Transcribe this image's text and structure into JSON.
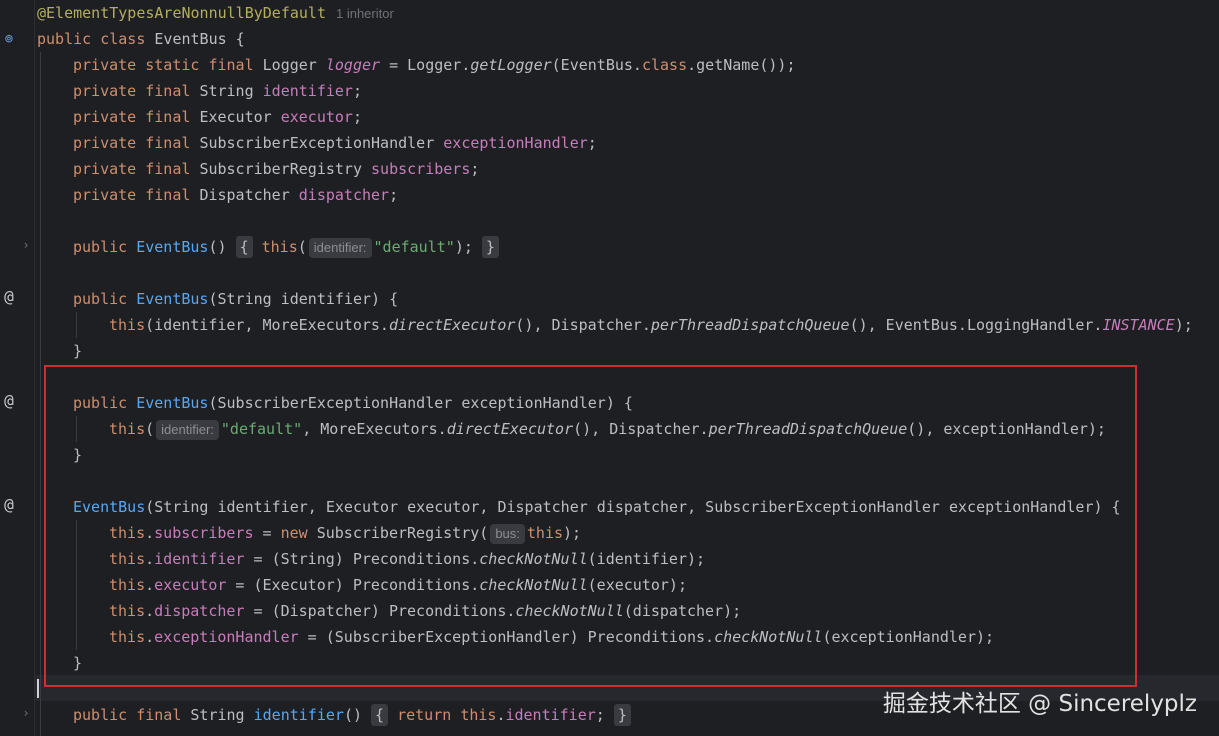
{
  "annotation": "@ElementTypesAreNonnullByDefault",
  "inheritor_hint": "1 inheritor",
  "gutter_icons": {
    "class_icon": "implemented-class-icon",
    "at_icon": "@"
  },
  "code": {
    "kw_public": "public",
    "kw_class": "class",
    "kw_private": "private",
    "kw_static": "static",
    "kw_final": "final",
    "kw_this": "this",
    "kw_new": "new",
    "kw_return": "return",
    "class_name": "EventBus",
    "open_brace": " {",
    "close_brace": "}",
    "logger_type": "Logger",
    "logger_field": "logger",
    "logger_init_a": " = Logger.",
    "logger_getLogger": "getLogger",
    "logger_init_b": "(EventBus.",
    "logger_class_kw": "class",
    "logger_init_c": ".getName());",
    "string_type": "String",
    "identifier_field": "identifier",
    "executor_type": "Executor",
    "executor_field": "executor",
    "handler_type": "SubscriberExceptionHandler",
    "handler_field": "exceptionHandler",
    "registry_type": "SubscriberRegistry",
    "subscribers_field": "subscribers",
    "dispatcher_type": "Dispatcher",
    "dispatcher_field": "dispatcher",
    "semicolon": ";",
    "ctor1_open": "()",
    "ctor1_body_open": "{",
    "ctor1_this_paren": "(",
    "hint_identifier": "identifier:",
    "str_default": "\"default\"",
    "ctor1_end": ");",
    "ctor1_body_close": "}",
    "ctor2_params": "(String identifier) {",
    "ctor2_body_a": "(identifier, MoreExecutors.",
    "direct_executor": "directExecutor",
    "ctor2_body_b": "(), Dispatcher.",
    "per_thread": "perThreadDispatchQueue",
    "ctor2_body_c": "(), EventBus.LoggingHandler.",
    "instance_const": "INSTANCE",
    "ctor2_body_d": ");",
    "ctor3_params": "(SubscriberExceptionHandler exceptionHandler) {",
    "ctor3_body_a": "(",
    "ctor3_body_b": ", MoreExecutors.",
    "ctor3_body_c": "(), Dispatcher.",
    "ctor3_body_d": "(), exceptionHandler);",
    "ctor4_params": "(String identifier, Executor executor, Dispatcher dispatcher, SubscriberExceptionHandler exceptionHandler) {",
    "dot": ".",
    "assign": " = ",
    "registry_ctor": "SubscriberRegistry(",
    "hint_bus": "bus:",
    "registry_end": ");",
    "cast_string": "(String) Preconditions.",
    "check_not_null": "checkNotNull",
    "arg_identifier": "(identifier);",
    "cast_executor": "(Executor) Preconditions.",
    "arg_executor": "(executor);",
    "cast_dispatcher": "(Dispatcher) Preconditions.",
    "arg_dispatcher": "(dispatcher);",
    "cast_handler": "(SubscriberExceptionHandler) Preconditions.",
    "arg_handler": "(exceptionHandler);",
    "getter_name": "identifier",
    "getter_parens": "()",
    "getter_body_open": "{",
    "getter_body_close": "}"
  },
  "watermark": "掘金技术社区 @ Sincerelyplz",
  "colors": {
    "background": "#1e1f22",
    "keyword": "#cf8e6d",
    "method_decl": "#56a8f5",
    "field": "#c77dbb",
    "string": "#6aab73",
    "annotation": "#b3ae60",
    "highlight_box": "#d12c33"
  }
}
